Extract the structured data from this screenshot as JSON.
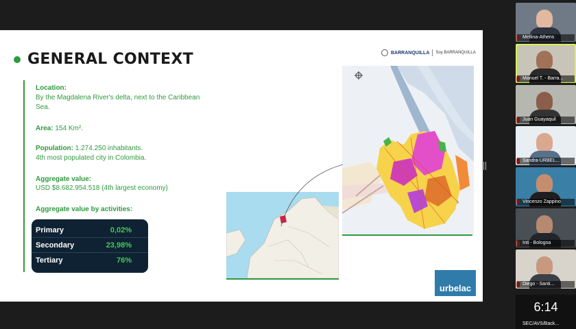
{
  "slide": {
    "title": "GENERAL CONTEXT",
    "logo_brand": "BARRANQUILLA",
    "logo_secondary": "Soy BARRANQUILLA",
    "location_label": "Location:",
    "location_line1": "By the Magdalena River's delta, next to the Caribbean",
    "location_line2": "Sea.",
    "area_label": "Area:",
    "area_value": "154 Km².",
    "population_label": "Population:",
    "population_value": "1.274.250 inhabitants.",
    "population_note": "4th most populated city in Colombia.",
    "aggregate_label": "Aggregate value:",
    "aggregate_value": "USD $8.682.954.518 (4th largest economy)",
    "activities_label": "Aggregate value by activities:",
    "activities": [
      {
        "name": "Primary",
        "value": "0,02%"
      },
      {
        "name": "Secondary",
        "value": "23,98%"
      },
      {
        "name": "Tertiary",
        "value": "76%"
      }
    ],
    "urbelac_logo": "urbelac"
  },
  "participants": [
    {
      "name": "Mellina-Athens"
    },
    {
      "name": "Manuel T. - Barra..."
    },
    {
      "name": "Juan Guayaquil"
    },
    {
      "name": "Sandra-URBEL..."
    },
    {
      "name": "Vincenzo Zappino"
    },
    {
      "name": "Inti - Bologna"
    },
    {
      "name": "Diego - Santi..."
    }
  ],
  "clock": "6:14",
  "last_participant": "SEC/AVS/Back..."
}
